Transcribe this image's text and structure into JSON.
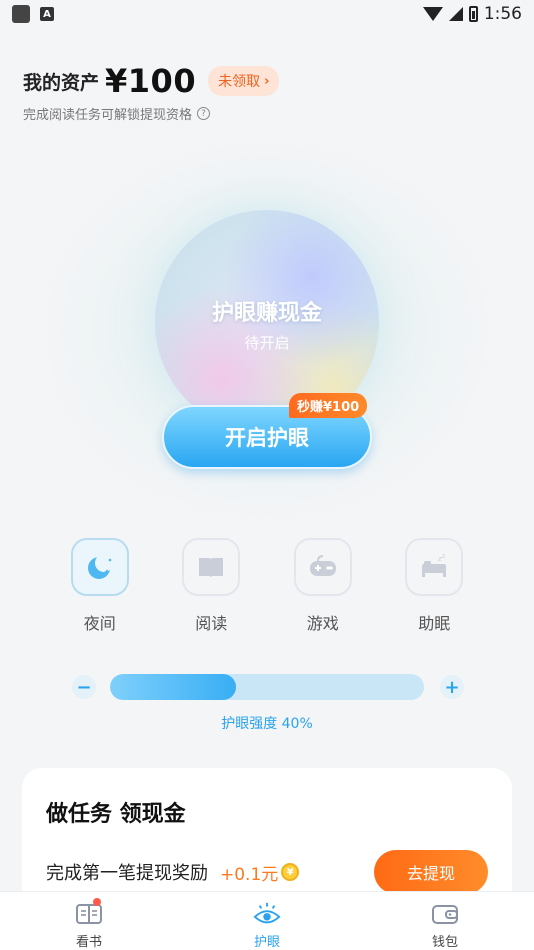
{
  "status_bar": {
    "time": "1:56"
  },
  "assets": {
    "label": "我的资产",
    "amount": "¥100",
    "claim_label": "未领取",
    "subtitle": "完成阅读任务可解锁提现资格"
  },
  "orb": {
    "title": "护眼赚现金",
    "status": "待开启",
    "start_label": "开启护眼",
    "bonus_tag": "秒赚¥100"
  },
  "modes": [
    {
      "label": "夜间",
      "icon": "moon-icon",
      "active": true
    },
    {
      "label": "阅读",
      "icon": "book-icon",
      "active": false
    },
    {
      "label": "游戏",
      "icon": "gamepad-icon",
      "active": false
    },
    {
      "label": "助眠",
      "icon": "bed-icon",
      "active": false
    }
  ],
  "intensity": {
    "value": 0.4,
    "caption": "护眼强度 40%"
  },
  "tasks": {
    "title": "做任务 领现金",
    "items": [
      {
        "name": "完成第一笔提现奖励",
        "reward": "+0.1元",
        "button": "去提现"
      }
    ]
  },
  "nav": [
    {
      "label": "看书",
      "icon": "book-nav-icon",
      "active": false,
      "badge": true
    },
    {
      "label": "护眼",
      "icon": "eye-nav-icon",
      "active": true,
      "badge": false
    },
    {
      "label": "钱包",
      "icon": "wallet-nav-icon",
      "active": false,
      "badge": false
    }
  ],
  "colors": {
    "accent_blue": "#2aa3ef",
    "accent_orange": "#ff7a1f"
  }
}
